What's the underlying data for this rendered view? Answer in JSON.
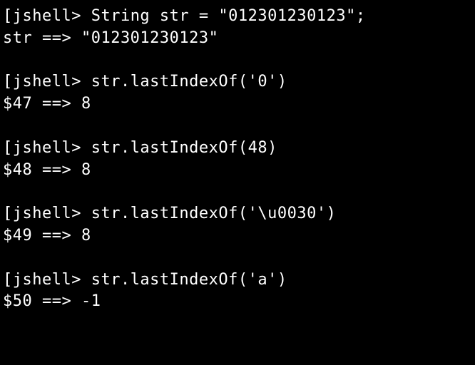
{
  "lines": [
    {
      "text": "jshell> String str = \"012301230123\";",
      "prompt": true
    },
    {
      "text": "str ==> \"012301230123\"",
      "prompt": false
    },
    {
      "text": "",
      "prompt": false
    },
    {
      "text": "jshell> str.lastIndexOf('0')",
      "prompt": true
    },
    {
      "text": "$47 ==> 8",
      "prompt": false
    },
    {
      "text": "",
      "prompt": false
    },
    {
      "text": "jshell> str.lastIndexOf(48)",
      "prompt": true
    },
    {
      "text": "$48 ==> 8",
      "prompt": false
    },
    {
      "text": "",
      "prompt": false
    },
    {
      "text": "jshell> str.lastIndexOf('\\u0030')",
      "prompt": true
    },
    {
      "text": "$49 ==> 8",
      "prompt": false
    },
    {
      "text": "",
      "prompt": false
    },
    {
      "text": "jshell> str.lastIndexOf('a')",
      "prompt": true
    },
    {
      "text": "$50 ==> -1",
      "prompt": false
    }
  ]
}
